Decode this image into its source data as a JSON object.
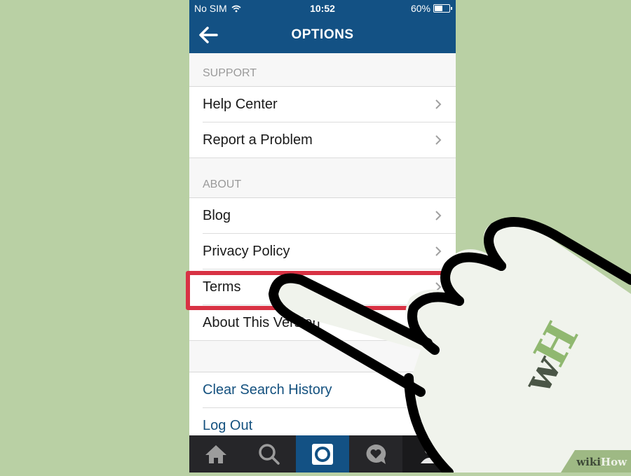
{
  "status_bar": {
    "carrier": "No SIM",
    "time": "10:52",
    "battery_percent_label": "60%",
    "battery_level": 0.6
  },
  "header": {
    "title": "OPTIONS",
    "back_icon": "arrow-left-icon"
  },
  "sections": [
    {
      "header": "SUPPORT",
      "items": [
        {
          "label": "Help Center"
        },
        {
          "label": "Report a Problem"
        }
      ]
    },
    {
      "header": "ABOUT",
      "items": [
        {
          "label": "Blog"
        },
        {
          "label": "Privacy Policy"
        },
        {
          "label": "Terms"
        },
        {
          "label": "About This Version"
        }
      ]
    }
  ],
  "actions": [
    {
      "label": "Clear Search History"
    },
    {
      "label": "Log Out"
    }
  ],
  "tab_bar": {
    "tabs": [
      {
        "icon": "home-icon"
      },
      {
        "icon": "search-icon"
      },
      {
        "icon": "camera-icon",
        "active": true
      },
      {
        "icon": "activity-heart-icon"
      },
      {
        "icon": "profile-icon"
      }
    ]
  },
  "annotation": {
    "highlighted_item": "Terms",
    "highlight_color": "#d83244",
    "hand_logo": "wH"
  },
  "colors": {
    "brand_blue": "#135184",
    "background_green": "#b9d0a4",
    "link_blue": "#14517f",
    "tabbar_dark": "#262629"
  },
  "watermark": {
    "part1": "wiki",
    "part2": "How"
  }
}
